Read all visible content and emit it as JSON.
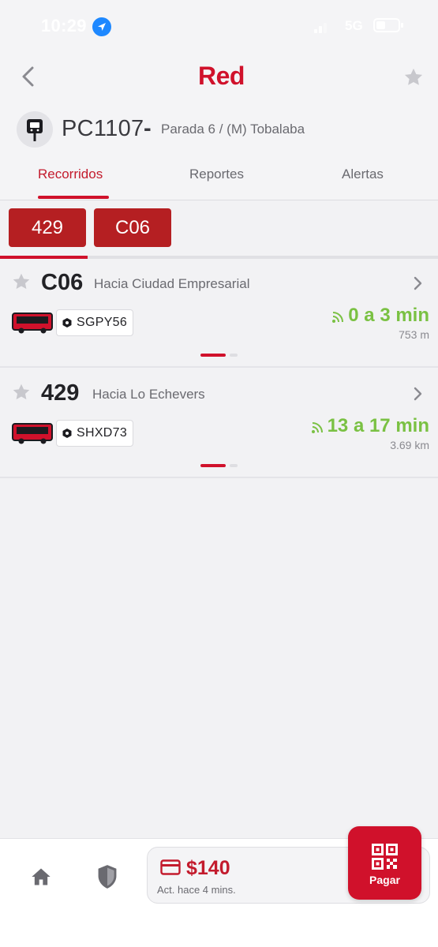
{
  "status_bar": {
    "time": "10:29",
    "network": "5G",
    "icons": [
      "location-arrow-icon",
      "signal-icon",
      "battery-icon"
    ]
  },
  "header": {
    "logo": "Red",
    "icons": [
      "chevron-left-icon",
      "star-icon"
    ],
    "stop": {
      "code": "PC1107",
      "separator": "-",
      "name": "Parada 6 / (M) Tobalaba",
      "icon": "bus-stop-icon"
    }
  },
  "tabs": [
    {
      "label": "Recorridos",
      "active": true
    },
    {
      "label": "Reportes",
      "active": false
    },
    {
      "label": "Alertas",
      "active": false
    }
  ],
  "route_chips": [
    {
      "label": "429"
    },
    {
      "label": "C06"
    }
  ],
  "routes": [
    {
      "number": "C06",
      "destination": "Hacia Ciudad Empresarial",
      "plate": "SGPY56",
      "eta": "0 a 3 min",
      "distance": "753 m"
    },
    {
      "number": "429",
      "destination": "Hacia Lo Echevers",
      "plate": "SHXD73",
      "eta": "13 a 17 min",
      "distance": "3.69 km"
    }
  ],
  "bottom_bar": {
    "balance": "$140",
    "updated": "Act. hace 4 mins.",
    "pay_label": "Pagar",
    "icons": [
      "home-icon",
      "shield-icon",
      "credit-card-icon",
      "qr-code-icon"
    ]
  },
  "colors": {
    "brand_red": "#d0112b",
    "chip_red": "#b51f22",
    "eta_green": "#7ac143",
    "background": "#f2f2f4"
  }
}
